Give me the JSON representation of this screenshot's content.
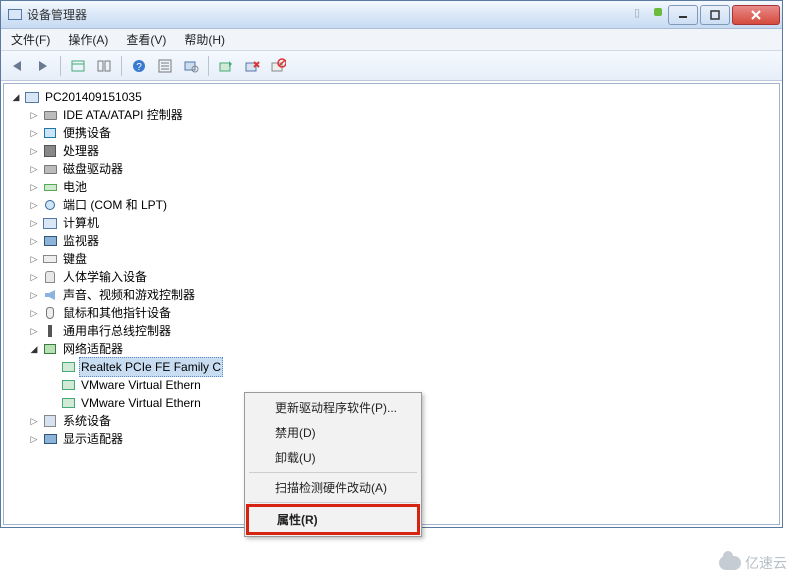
{
  "window": {
    "title": "设备管理器",
    "bg_pill": "●",
    "bg_text": "●●●●●_●"
  },
  "menu": {
    "file": "文件(F)",
    "action": "操作(A)",
    "view": "查看(V)",
    "help": "帮助(H)"
  },
  "tree": {
    "root": "PC201409151035",
    "items": [
      "IDE ATA/ATAPI 控制器",
      "便携设备",
      "处理器",
      "磁盘驱动器",
      "电池",
      "端口 (COM 和 LPT)",
      "计算机",
      "监视器",
      "键盘",
      "人体学输入设备",
      "声音、视频和游戏控制器",
      "鼠标和其他指针设备",
      "通用串行总线控制器",
      "网络适配器",
      "系统设备",
      "显示适配器"
    ],
    "network_children": [
      "Realtek PCIe FE Family C",
      "VMware Virtual Ethern",
      "VMware Virtual Ethern"
    ]
  },
  "context_menu": {
    "update": "更新驱动程序软件(P)...",
    "disable": "禁用(D)",
    "uninstall": "卸载(U)",
    "scan": "扫描检测硬件改动(A)",
    "properties": "属性(R)"
  },
  "watermark": "亿速云"
}
